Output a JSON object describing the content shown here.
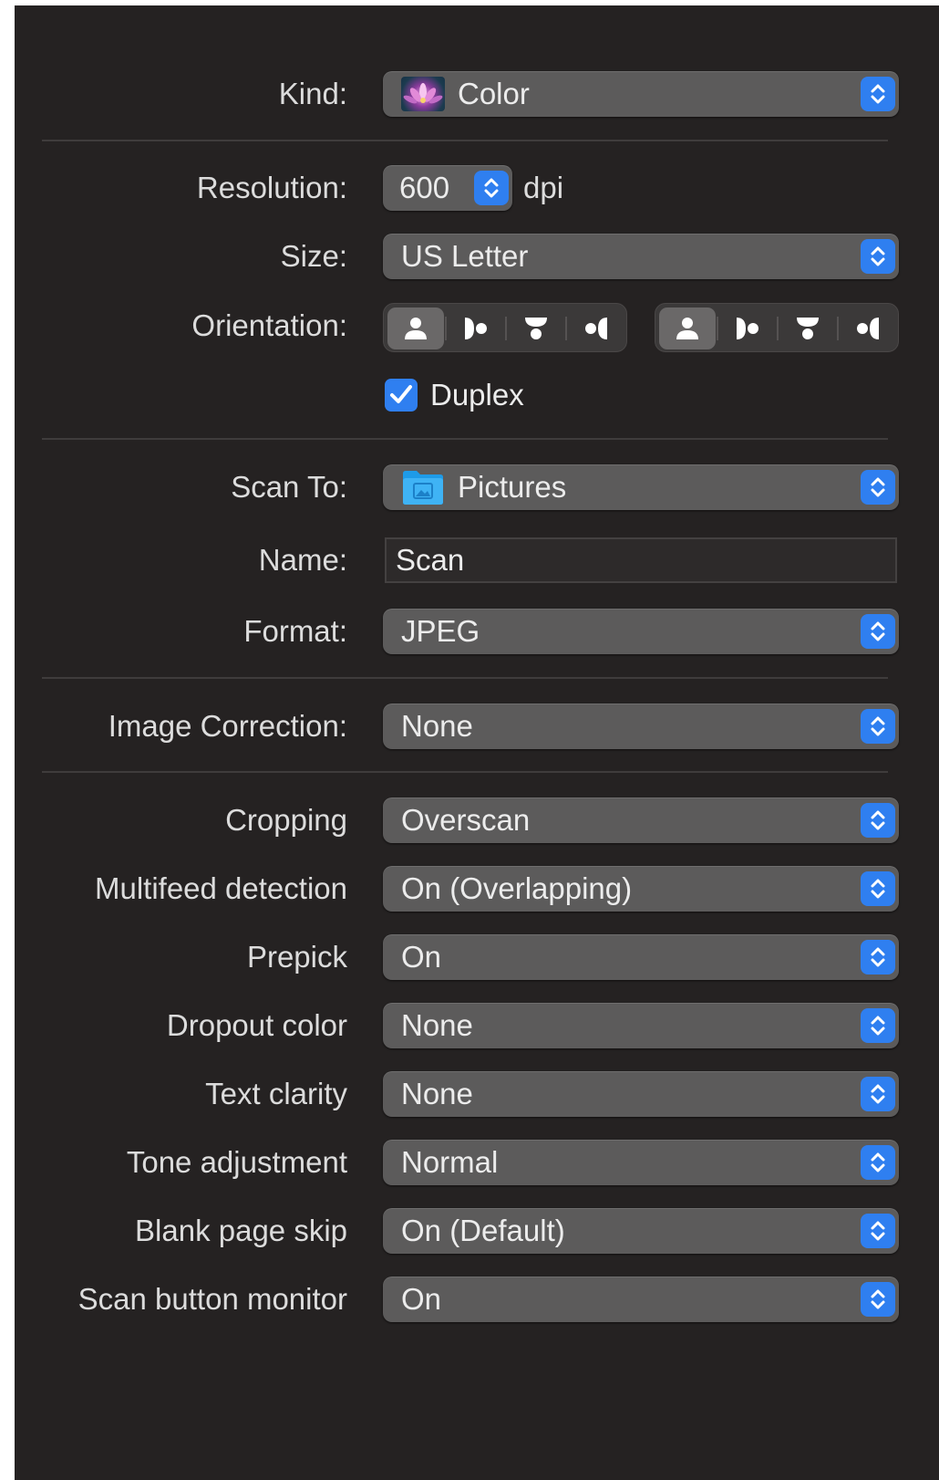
{
  "kind": {
    "label": "Kind:",
    "value": "Color",
    "icon": "flower-photo-icon"
  },
  "resolution": {
    "label": "Resolution:",
    "value": "600",
    "unit": "dpi"
  },
  "size": {
    "label": "Size:",
    "value": "US Letter"
  },
  "orientation": {
    "label": "Orientation:",
    "groups": [
      {
        "options": [
          "upright",
          "rotate-right",
          "upside-down",
          "rotate-left"
        ],
        "selected": "upright"
      },
      {
        "options": [
          "upright",
          "rotate-right",
          "upside-down",
          "rotate-left"
        ],
        "selected": "upright"
      }
    ]
  },
  "duplex": {
    "label": "Duplex",
    "checked": true
  },
  "scan_to": {
    "label": "Scan To:",
    "value": "Pictures",
    "icon": "pictures-folder-icon"
  },
  "name": {
    "label": "Name:",
    "value": "Scan"
  },
  "format": {
    "label": "Format:",
    "value": "JPEG"
  },
  "image_correction": {
    "label": "Image Correction:",
    "value": "None"
  },
  "cropping": {
    "label": "Cropping",
    "value": "Overscan"
  },
  "multifeed_detection": {
    "label": "Multifeed detection",
    "value": "On (Overlapping)"
  },
  "prepick": {
    "label": "Prepick",
    "value": "On"
  },
  "dropout_color": {
    "label": "Dropout color",
    "value": "None"
  },
  "text_clarity": {
    "label": "Text clarity",
    "value": "None"
  },
  "tone_adjustment": {
    "label": "Tone adjustment",
    "value": "Normal"
  },
  "blank_page_skip": {
    "label": "Blank page skip",
    "value": "On (Default)"
  },
  "scan_button_monitor": {
    "label": "Scan button monitor",
    "value": "On"
  },
  "colors": {
    "panel": "#252222",
    "popup": "#5c5b5b",
    "accent": "#2f7ff0",
    "text": "#dcdcdc"
  }
}
